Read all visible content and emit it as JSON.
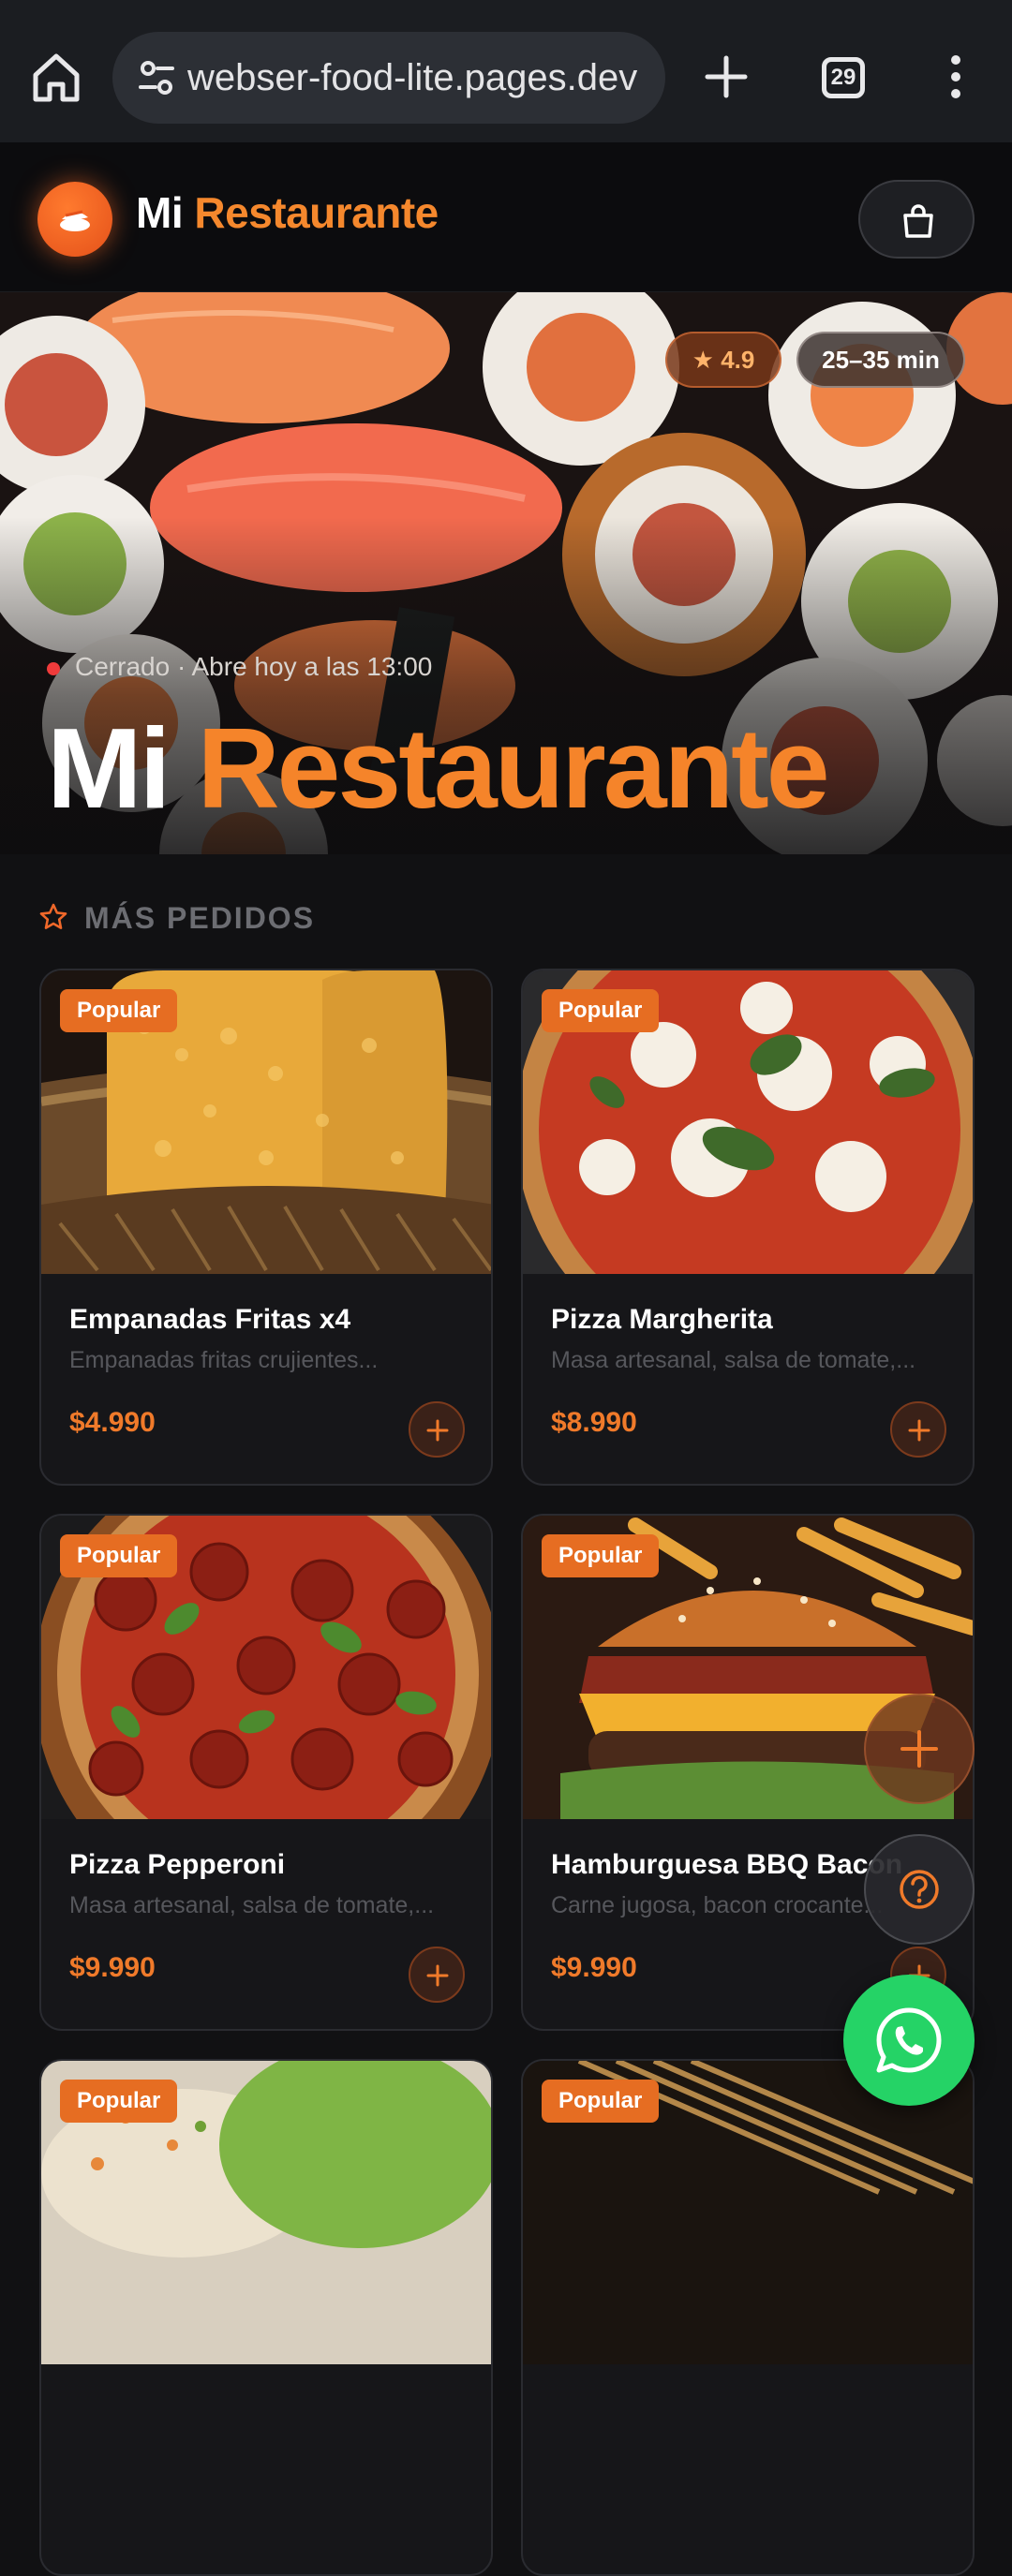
{
  "browser": {
    "url": "webser-food-lite.pages.dev",
    "tab_count": "29",
    "icons": [
      "home-icon",
      "site-settings-icon",
      "new-tab-icon",
      "tabs-icon",
      "more-vert-icon"
    ]
  },
  "header": {
    "brand_first": "Mi",
    "brand_second": "Restaurante",
    "logo_icon": "sushi-icon",
    "cart_icon": "shopping-bag-icon"
  },
  "hero": {
    "rating": "★ 4.9",
    "delivery_time": "25–35 min",
    "status": "Cerrado · Abre hoy a las 13:00",
    "title_first": "Mi",
    "title_second": "Restaurante"
  },
  "section": {
    "title": "MÁS PEDIDOS",
    "icon": "star-icon"
  },
  "products": [
    {
      "badge": "Popular",
      "name": "Empanadas Fritas x4",
      "description": "Empanadas fritas crujientes...",
      "price": "$4.990"
    },
    {
      "badge": "Popular",
      "name": "Pizza Margherita",
      "description": "Masa artesanal, salsa de tomate,...",
      "price": "$8.990"
    },
    {
      "badge": "Popular",
      "name": "Pizza Pepperoni",
      "description": "Masa artesanal, salsa de tomate,...",
      "price": "$9.990"
    },
    {
      "badge": "Popular",
      "name": "Hamburguesa BBQ Bacon",
      "description": "Carne jugosa, bacon crocante...",
      "price": "$9.990"
    },
    {
      "badge": "Popular"
    },
    {
      "badge": "Popular"
    }
  ],
  "colors": {
    "accent": "#f5842a",
    "whatsapp": "#25d366",
    "background": "#111113"
  }
}
